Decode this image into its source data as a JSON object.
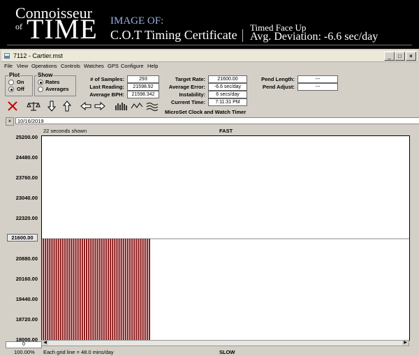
{
  "banner": {
    "brand_small": "Connoisseur",
    "brand_of": "of",
    "brand_time": "TIME",
    "image_of": "IMAGE OF:",
    "cert_title": "C.O.T Timing Certificate",
    "timed_face_up": "Timed Face Up",
    "avg_deviation": "Avg. Deviation:  -6.6 sec/day"
  },
  "window": {
    "title": "7112 - Cartier.mst",
    "buttons": {
      "minimize": "_",
      "maximize": "□",
      "close": "×"
    },
    "menu": [
      "File",
      "View",
      "Operations",
      "Controls",
      "Watches",
      "GPS",
      "Configure",
      "Help"
    ]
  },
  "plot_group": {
    "label": "Plot",
    "on": "On",
    "off": "Off",
    "selected": "Off"
  },
  "show_group": {
    "label": "Show",
    "rates": "Rates",
    "averages": "Averages",
    "selected": "Rates"
  },
  "stats": {
    "samples_label": "# of Samples:",
    "samples": "293",
    "last_reading_label": "Last Reading:",
    "last_reading": "21598.92",
    "avg_bph_label": "Average BPH:",
    "avg_bph": "21598.342",
    "target_rate_label": "Target Rate:",
    "target_rate": "21600.00",
    "avg_error_label": "Average Error:",
    "avg_error": "-6.6 sec/day",
    "instability_label": "Instability:",
    "instability": "6 secs/day",
    "current_time_label": "Current Time:",
    "current_time": "7:11:31 PM",
    "pend_length_label": "Pend Length:",
    "pend_length": "---",
    "pend_adjust_label": "Pend Adjust:",
    "pend_adjust": "---"
  },
  "timer_label": "MicroSet Clock and Watch Timer",
  "date": "10/16/2019",
  "date_clear": "×",
  "chart_header": {
    "shown": "22 seconds shown",
    "fast": "FAST"
  },
  "footer": {
    "zoom": "100.00%",
    "zoom_input": "0",
    "grid_note": "Each grid line = 48.0 mins/day",
    "slow": "SLOW"
  },
  "colors": {
    "bar": "#8b1a1a",
    "bar_gap": "#ffffff",
    "accent_blue": "#9ab0e6",
    "delete_icon": "#cc0000"
  },
  "chart_data": {
    "type": "bar",
    "y_ticks": [
      "25200.00",
      "24480.00",
      "23760.00",
      "23040.00",
      "22320.00",
      "21600.00",
      "20880.00",
      "20160.00",
      "19440.00",
      "18720.00",
      "18000.00"
    ],
    "ylim": [
      18000,
      25200
    ],
    "highlighted_tick": "21600.00",
    "x_samples": 293,
    "bar_value": 21598.92,
    "bar_count": 50,
    "grid": true
  }
}
